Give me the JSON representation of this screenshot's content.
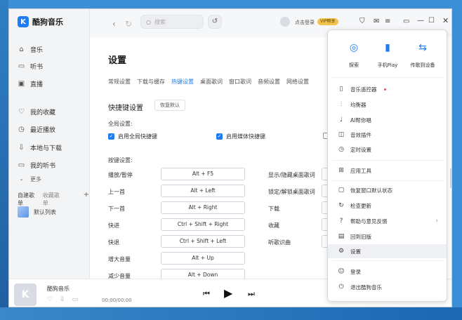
{
  "app": {
    "name": "酷狗音乐",
    "logo_letter": "K"
  },
  "sidebar": {
    "items": [
      {
        "label": "音乐",
        "icon": "home-icon"
      },
      {
        "label": "听书",
        "icon": "book-icon"
      },
      {
        "label": "直播",
        "icon": "live-icon"
      },
      {
        "label": "我的收藏",
        "icon": "heart-icon"
      },
      {
        "label": "最近播放",
        "icon": "clock-icon"
      },
      {
        "label": "本地与下载",
        "icon": "download-icon"
      },
      {
        "label": "我的听书",
        "icon": "book-icon"
      }
    ],
    "more": "更多",
    "tabs": [
      "自建歌单",
      "收藏歌单"
    ],
    "playlist": "默认列表"
  },
  "topbar": {
    "search_placeholder": "搜索",
    "login": "点击登录",
    "vip": "VIP畅享"
  },
  "settings": {
    "title": "设置",
    "tabs": [
      "常规设置",
      "下载与缓存",
      "热键设置",
      "桌面歌词",
      "窗口歌词",
      "音频设置",
      "网络设置"
    ],
    "active_tab": "热键设置",
    "section": "快捷键设置",
    "reset": "恢复默认",
    "global_label": "全局设置:",
    "global_check": "启用全局快捷键",
    "media_check": "启用媒体快捷键",
    "hotkey_label": "按键设置:",
    "left_keys": [
      {
        "action": "播放/暂停",
        "key": "Alt + F5"
      },
      {
        "action": "上一首",
        "key": "Alt + Left"
      },
      {
        "action": "下一首",
        "key": "Alt + Right"
      },
      {
        "action": "快进",
        "key": "Ctrl + Shift + Right"
      },
      {
        "action": "快退",
        "key": "Ctrl + Shift + Left"
      },
      {
        "action": "增大音量",
        "key": "Alt + Up"
      },
      {
        "action": "减少音量",
        "key": "Alt + Down"
      }
    ],
    "right_actions": [
      "显示/隐藏桌面歌词",
      "锁定/解锁桌面歌词",
      "下载",
      "收藏",
      "听歌识曲"
    ]
  },
  "player": {
    "song": "酷狗音乐",
    "time": "00:00/00:00"
  },
  "menu": {
    "quick": [
      {
        "label": "探索",
        "icon": "explore-icon"
      },
      {
        "label": "手机Play",
        "icon": "phone-play-icon"
      },
      {
        "label": "传歌到设备",
        "icon": "transfer-icon"
      }
    ],
    "items": [
      {
        "label": "音乐遥控器",
        "icon": "remote-icon"
      },
      {
        "label": "均衡器",
        "icon": "equalizer-icon"
      },
      {
        "label": "AI帮你唱",
        "icon": "ai-sing-icon"
      },
      {
        "label": "音效插件",
        "icon": "plugin-icon"
      },
      {
        "label": "定时设置",
        "icon": "timer-icon"
      },
      {
        "label": "应用工具",
        "icon": "apps-icon"
      },
      {
        "label": "恢复窗口默认状态",
        "icon": "restore-icon"
      },
      {
        "label": "检查更新",
        "icon": "update-icon"
      },
      {
        "label": "帮助与意见反馈",
        "icon": "help-icon"
      },
      {
        "label": "回到旧版",
        "icon": "old-version-icon"
      },
      {
        "label": "设置",
        "icon": "settings-icon"
      },
      {
        "label": "登录",
        "icon": "login-icon"
      },
      {
        "label": "退出酷狗音乐",
        "icon": "power-icon"
      }
    ]
  },
  "colors": {
    "accent": "#1f7cf2",
    "badge": "#ef4c4c"
  }
}
